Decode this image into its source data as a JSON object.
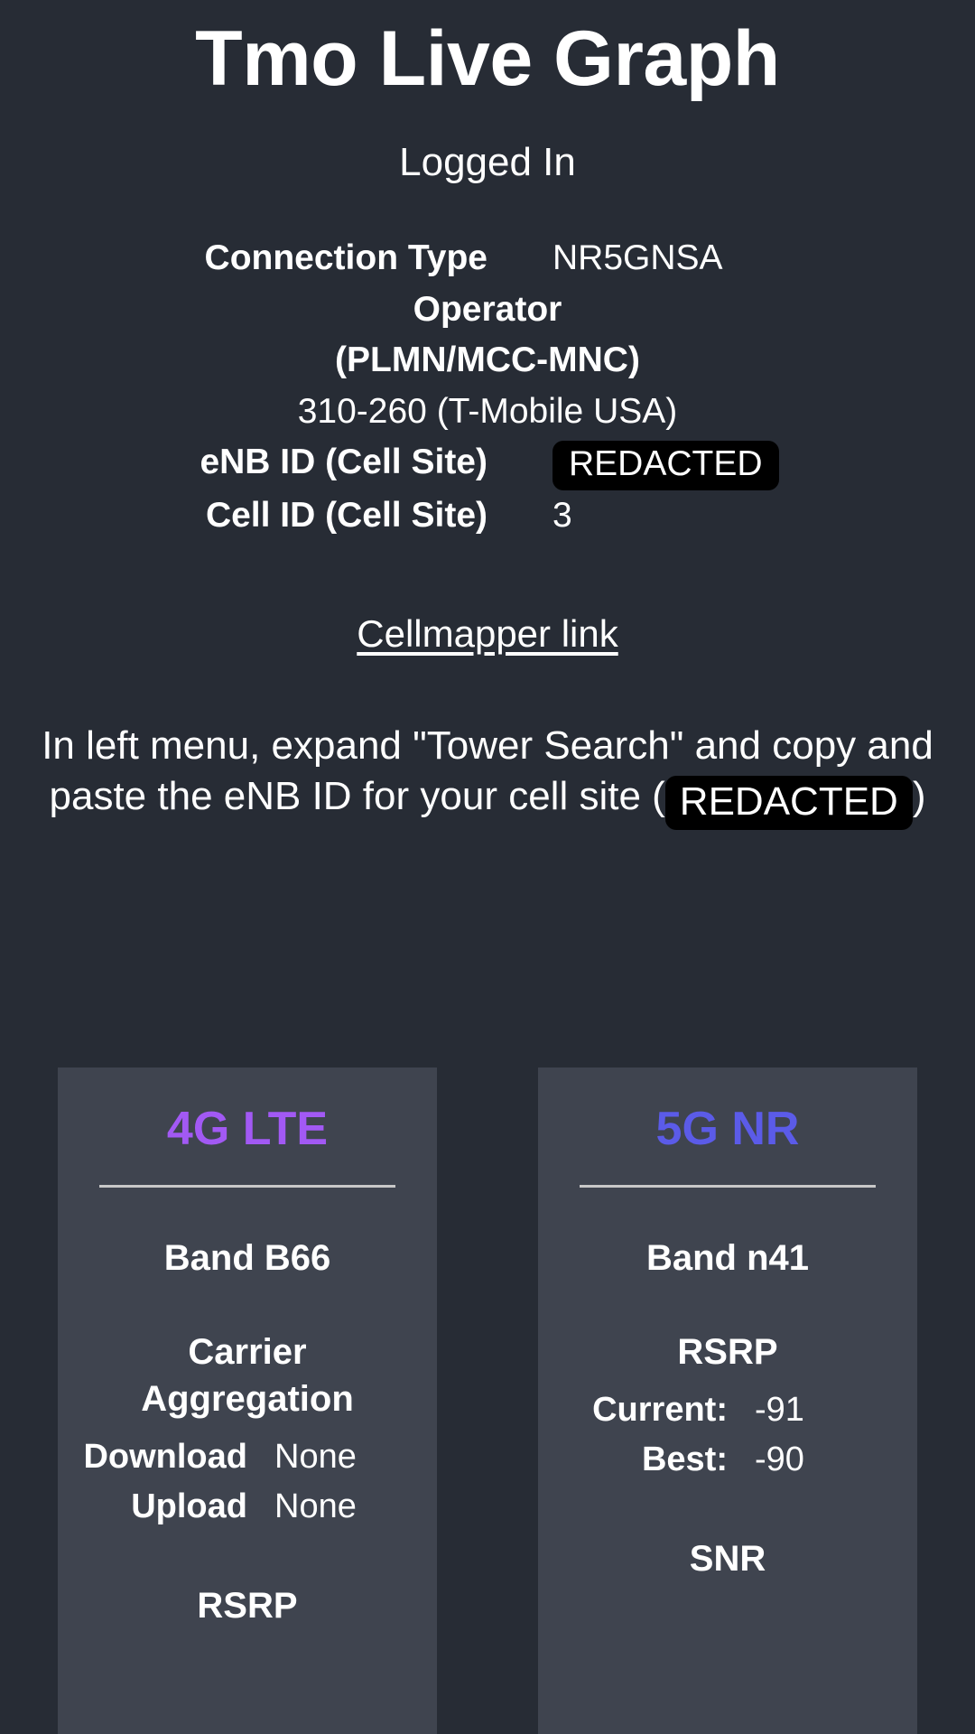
{
  "app": {
    "title": "Tmo Live Graph",
    "login_status": "Logged In"
  },
  "colors": {
    "page_background": "#272c35",
    "card_background": "#3f444f",
    "lte_accent": "#a259f4",
    "nr_accent": "#5b5be8",
    "divider": "#c8c8c8",
    "redacted_background": "#000000",
    "text": "#ffffff"
  },
  "info": {
    "connection_type": {
      "label": "Connection Type",
      "value": "NR5GNSA"
    },
    "operator": {
      "label_line1": "Operator",
      "label_line2": "(PLMN/MCC-MNC)",
      "value": "310-260 (T-Mobile USA)"
    },
    "enb_id": {
      "label": "eNB ID (Cell Site)",
      "value": "REDACTED"
    },
    "cell_id": {
      "label": "Cell ID (Cell Site)",
      "value": "3"
    }
  },
  "link": {
    "cellmapper": "Cellmapper link"
  },
  "instructions": {
    "part1": "In left menu, expand \"Tower Search\" and copy and paste the eNB ID for your cell site (",
    "redacted": "REDACTED",
    "part2": ")"
  },
  "cards": {
    "lte": {
      "title": "4G LTE",
      "band_label": "Band B66",
      "carrier_aggregation_label": "Carrier Aggregation",
      "download_key": "Download",
      "download_value": "None",
      "upload_key": "Upload",
      "upload_value": "None",
      "rsrp_label": "RSRP"
    },
    "nr": {
      "title": "5G NR",
      "band_label": "Band n41",
      "rsrp_label": "RSRP",
      "current_key": "Current:",
      "current_value": "-91",
      "best_key": "Best:",
      "best_value": "-90",
      "snr_label": "SNR"
    }
  }
}
